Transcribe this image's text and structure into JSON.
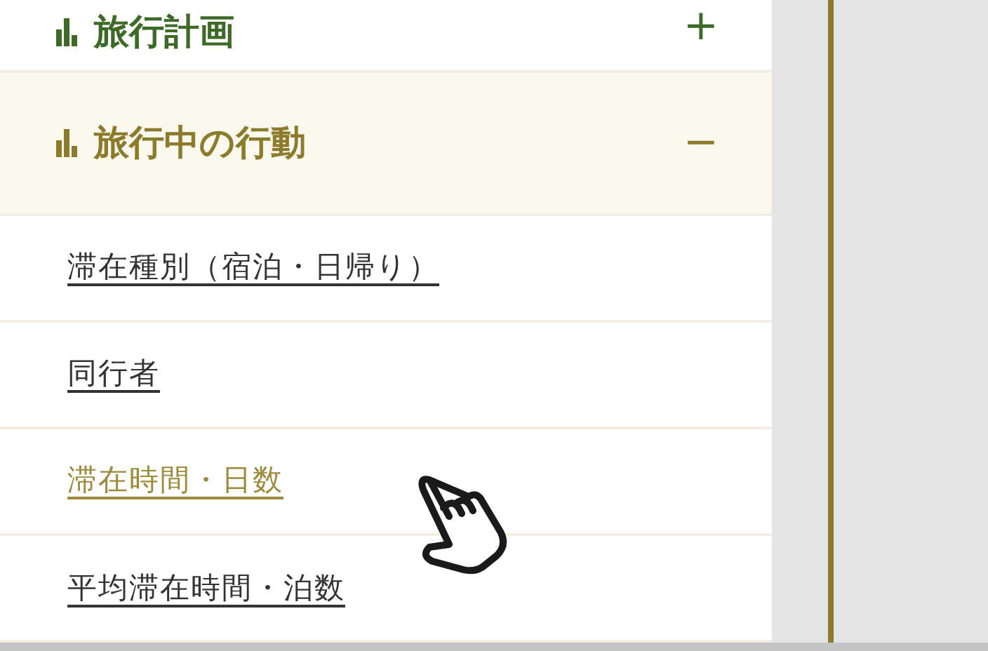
{
  "sections": [
    {
      "title": "旅行計画",
      "toggle": "+",
      "selected": false
    },
    {
      "title": "旅行中の行動",
      "toggle": "−",
      "selected": true,
      "items": [
        {
          "label": "滞在種別（宿泊・日帰り）",
          "hovered": false
        },
        {
          "label": "同行者",
          "hovered": false
        },
        {
          "label": "滞在時間・日数",
          "hovered": true
        },
        {
          "label": "平均滞在時間・泊数",
          "hovered": false
        }
      ]
    }
  ]
}
